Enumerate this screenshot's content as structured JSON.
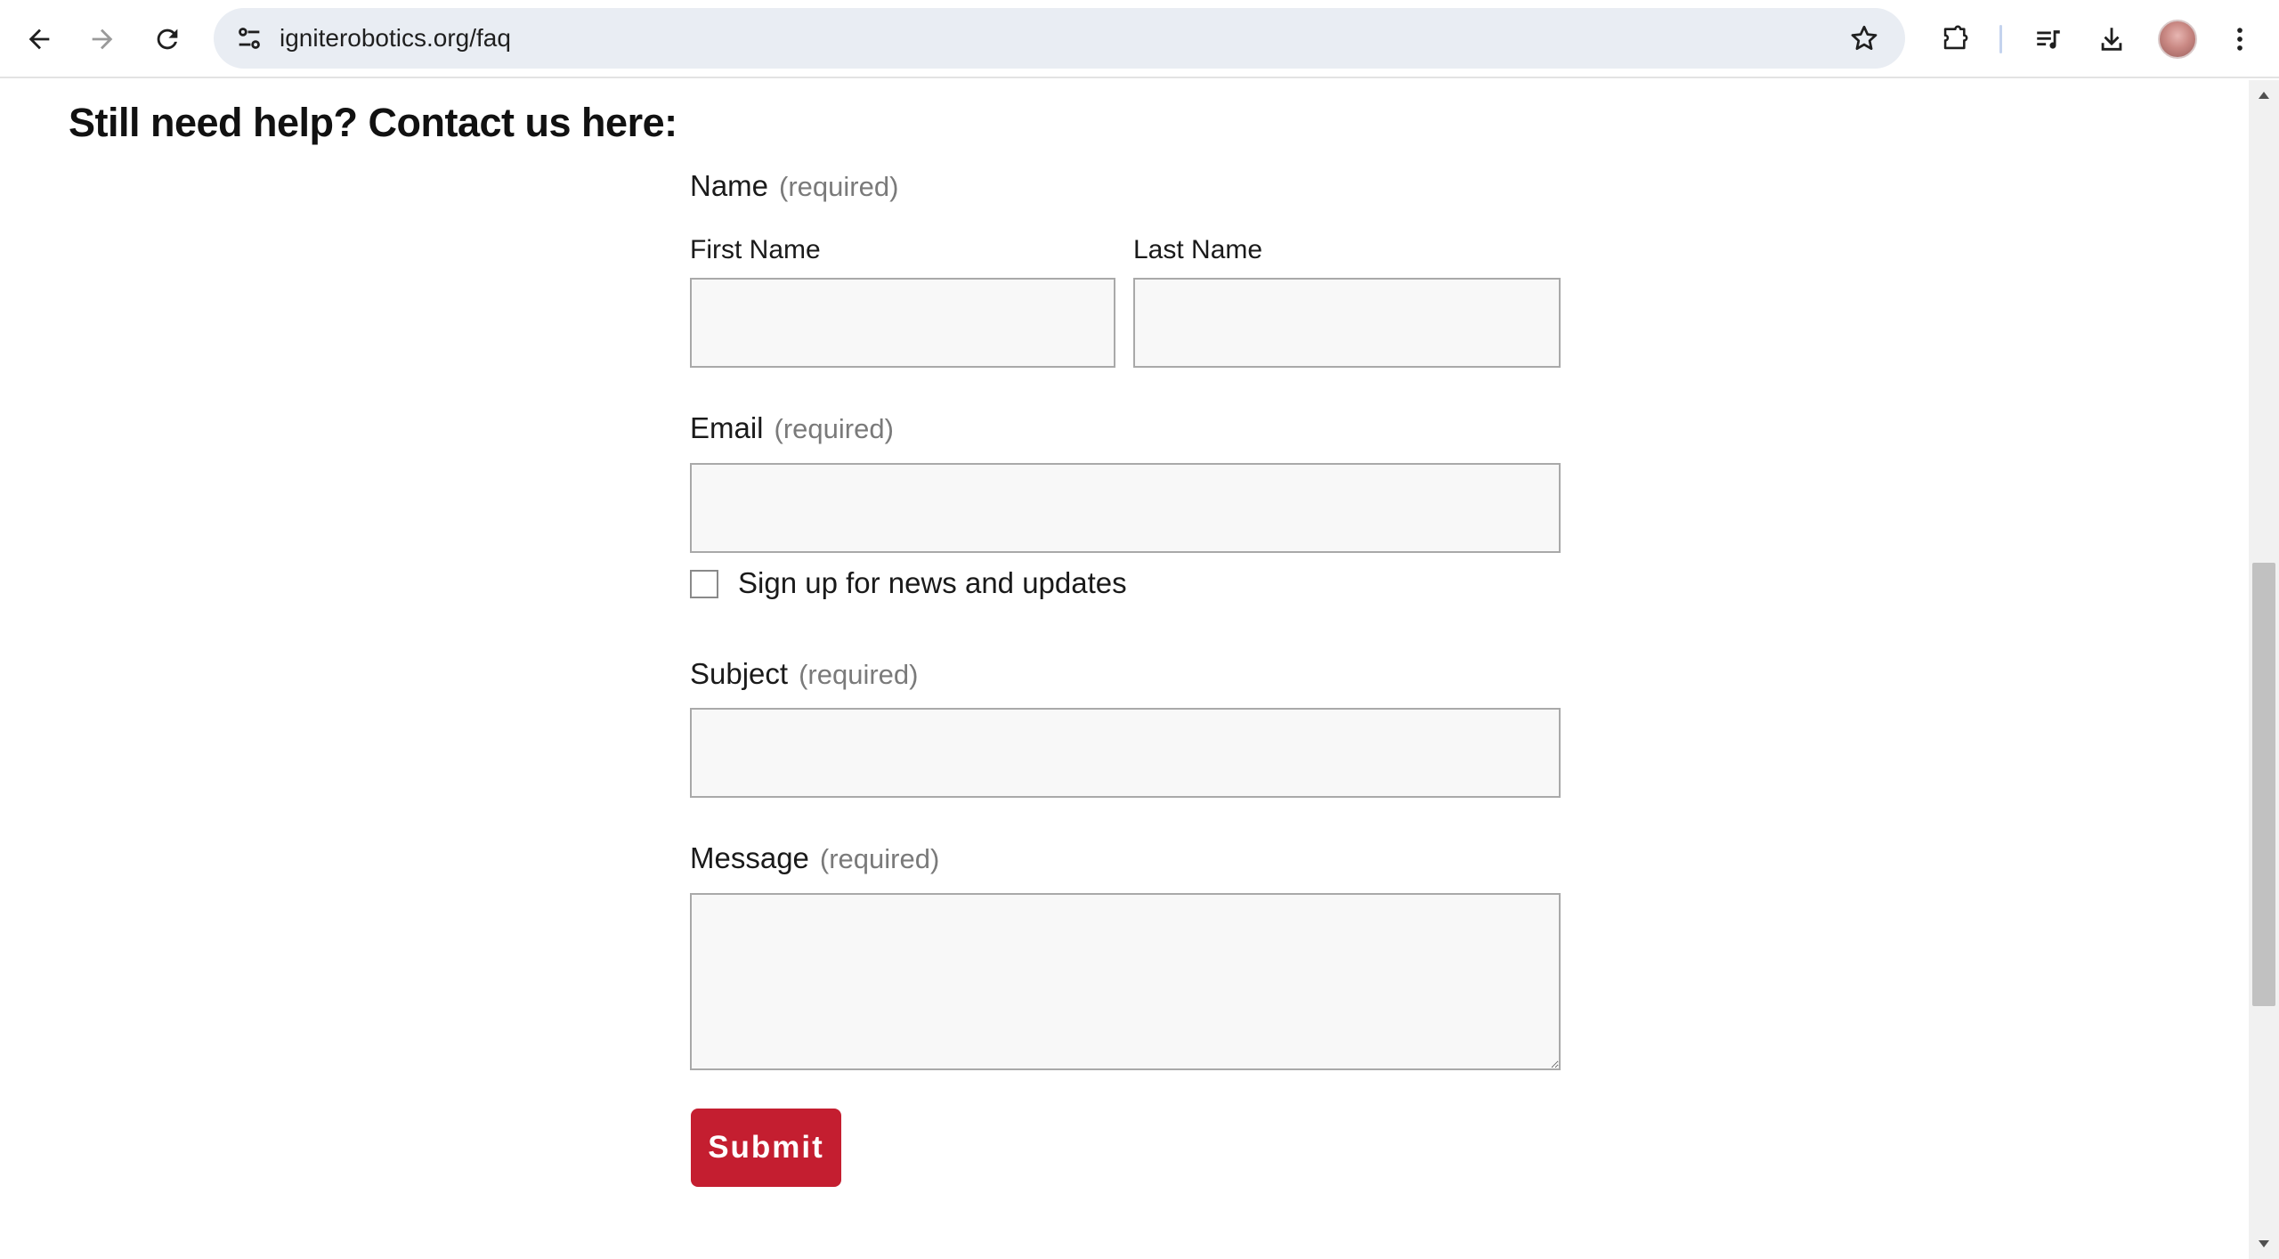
{
  "browser": {
    "url": "igniterobotics.org/faq",
    "icons": {
      "back": "arrow-left-icon",
      "forward": "arrow-right-icon",
      "reload": "reload-icon",
      "site_info": "tune-icon",
      "bookmark": "star-icon",
      "extensions": "puzzle-icon",
      "media": "media-queue-icon",
      "downloads": "download-icon",
      "profile": "avatar",
      "menu": "kebab-menu-icon"
    }
  },
  "page": {
    "heading": "Still need help? Contact us here:",
    "form": {
      "name": {
        "label": "Name",
        "required": "(required)"
      },
      "first_name": {
        "label": "First Name",
        "value": ""
      },
      "last_name": {
        "label": "Last Name",
        "value": ""
      },
      "email": {
        "label": "Email",
        "required": "(required)",
        "value": ""
      },
      "newsletter": {
        "label": "Sign up for news and updates",
        "checked": false
      },
      "subject": {
        "label": "Subject",
        "required": "(required)",
        "value": ""
      },
      "message": {
        "label": "Message",
        "required": "(required)",
        "value": ""
      },
      "submit_label": "Submit"
    }
  },
  "colors": {
    "accent": "#c41e30",
    "field_bg": "#f8f8f8",
    "field_border": "#a9a9a9",
    "omnibox_bg": "#e9edf3"
  }
}
